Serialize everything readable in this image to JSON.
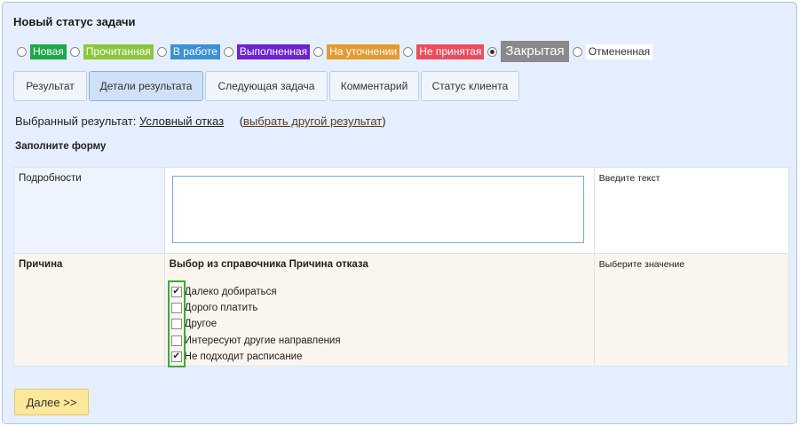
{
  "header": {
    "title": "Новый статус задачи"
  },
  "statuses": [
    {
      "label": "Новая",
      "color": "#1fa84a",
      "selected": false
    },
    {
      "label": "Прочитанная",
      "color": "#8cc63f",
      "selected": false
    },
    {
      "label": "В работе",
      "color": "#3d8fd6",
      "selected": false
    },
    {
      "label": "Выполненная",
      "color": "#6a23d0",
      "selected": false
    },
    {
      "label": "На уточнении",
      "color": "#e59a31",
      "selected": false
    },
    {
      "label": "Не принятая",
      "color": "#eb4d5c",
      "selected": false
    },
    {
      "label": "Закрытая",
      "color": "#8a8a8a",
      "selected": true
    },
    {
      "label": "Отмененная",
      "color": "#ffffff",
      "selected": false
    }
  ],
  "tabs": [
    {
      "label": "Результат"
    },
    {
      "label": "Детали результата"
    },
    {
      "label": "Следующая задача"
    },
    {
      "label": "Комментарий"
    },
    {
      "label": "Статус клиента"
    }
  ],
  "result": {
    "prefix": "Выбранный результат:",
    "value": "Условный отказ",
    "paren_open": "(",
    "change_link": "выбрать другой результат",
    "paren_close": ")"
  },
  "form": {
    "heading": "Заполните форму",
    "details": {
      "label": "Подробности",
      "value": "",
      "hint": "Введите текст"
    },
    "reason": {
      "label": "Причина",
      "title": "Выбор из справочника Причина отказа",
      "hint": "Выберите значение",
      "options": [
        {
          "label": "Далеко добираться",
          "checked": true
        },
        {
          "label": "Дорого платить",
          "checked": false
        },
        {
          "label": "Другое",
          "checked": false
        },
        {
          "label": "Интересуют другие направления",
          "checked": false
        },
        {
          "label": "Не подходит расписание",
          "checked": true
        }
      ]
    }
  },
  "footer": {
    "next_label": "Далее >>"
  }
}
